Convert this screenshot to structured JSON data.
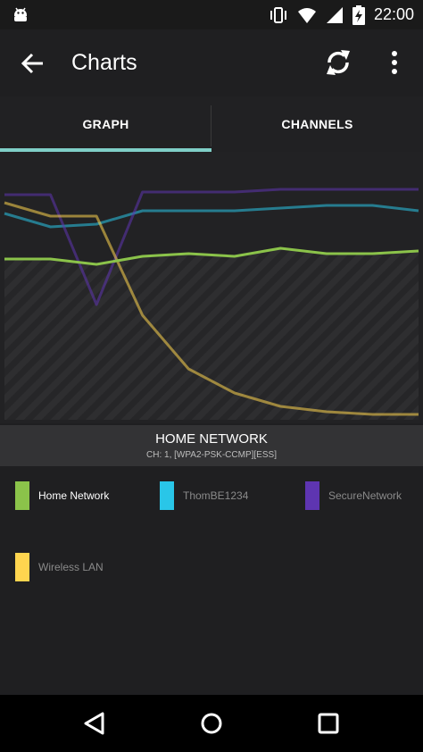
{
  "status_bar": {
    "time": "22:00",
    "icons": [
      "android-debug-icon",
      "vibrate-icon",
      "wifi-icon",
      "signal-icon",
      "battery-charging-icon"
    ]
  },
  "app_bar": {
    "title": "Charts",
    "icons": [
      "back-arrow-icon",
      "refresh-icon",
      "more-vert-icon"
    ]
  },
  "tabs": [
    {
      "label": "GRAPH",
      "selected": true
    },
    {
      "label": "CHANNELS",
      "selected": false
    }
  ],
  "selected_network": {
    "name": "HOME NETWORK",
    "detail": "CH: 1, [WPA2-PSK-CCMP][ESS]"
  },
  "legend": [
    {
      "label": "Home Network",
      "color": "#8bc34a",
      "active": true
    },
    {
      "label": "ThomBE1234",
      "color": "#29c6e8",
      "active": false
    },
    {
      "label": "SecureNetwork",
      "color": "#5e35b1",
      "active": false
    },
    {
      "label": "Wireless LAN",
      "color": "#ffd54f",
      "active": false
    }
  ],
  "chart_data": {
    "type": "line",
    "title": "",
    "xlabel": "",
    "ylabel": "",
    "x": [
      0,
      1,
      2,
      3,
      4,
      5,
      6,
      7,
      8,
      9
    ],
    "ylim": [
      0,
      100
    ],
    "grid": false,
    "highlighted_series": "Home Network",
    "series": [
      {
        "name": "Home Network",
        "color": "#8bc34a",
        "values": [
          60,
          60,
          58,
          61,
          62,
          61,
          64,
          62,
          62,
          63
        ]
      },
      {
        "name": "ThomBE1234",
        "color": "#29c6e8",
        "values": [
          77,
          72,
          73,
          78,
          78,
          78,
          79,
          80,
          80,
          78
        ]
      },
      {
        "name": "SecureNetwork",
        "color": "#5e35b1",
        "values": [
          84,
          84,
          43,
          85,
          85,
          85,
          86,
          86,
          86,
          86
        ]
      },
      {
        "name": "Wireless LAN",
        "color": "#ffd54f",
        "values": [
          81,
          76,
          76,
          39,
          19,
          10,
          5,
          3,
          2,
          2
        ]
      }
    ]
  },
  "nav_bar": {
    "icons": [
      "back-triangle-icon",
      "home-circle-icon",
      "recents-square-icon"
    ]
  }
}
